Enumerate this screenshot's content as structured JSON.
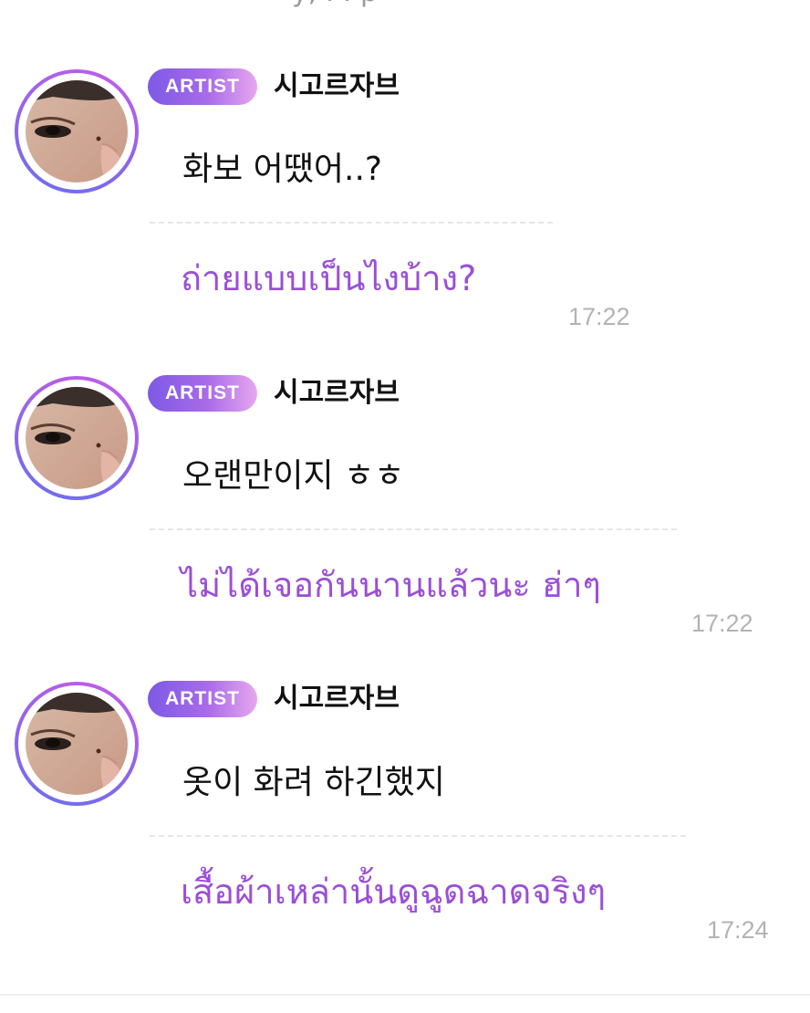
{
  "top_cut_text": "y, . . p",
  "colors": {
    "accent_purple": "#9a4fd6",
    "badge_gradient_start": "#7c5ae6",
    "badge_gradient_end": "#e7a7ef",
    "timestamp_gray": "#b3b3b3"
  },
  "messages": [
    {
      "badge": "ARTIST",
      "name": "시고르자브",
      "avatar_icon": "artist-avatar",
      "text": "화보 어땠어..?",
      "translation": "ถ่ายแบบเป็นไงบ้าง?",
      "time": "17:22"
    },
    {
      "badge": "ARTIST",
      "name": "시고르자브",
      "avatar_icon": "artist-avatar",
      "text": "오랜만이지 ㅎㅎ",
      "translation": "ไม่ได้เจอกันนานแล้วนะ ฮ่าๆ",
      "time": "17:22"
    },
    {
      "badge": "ARTIST",
      "name": "시고르자브",
      "avatar_icon": "artist-avatar",
      "text": "옷이 화려 하긴했지",
      "translation": "เสื้อผ้าเหล่านั้นดูฉูดฉาดจริงๆ",
      "time": "17:24"
    }
  ]
}
